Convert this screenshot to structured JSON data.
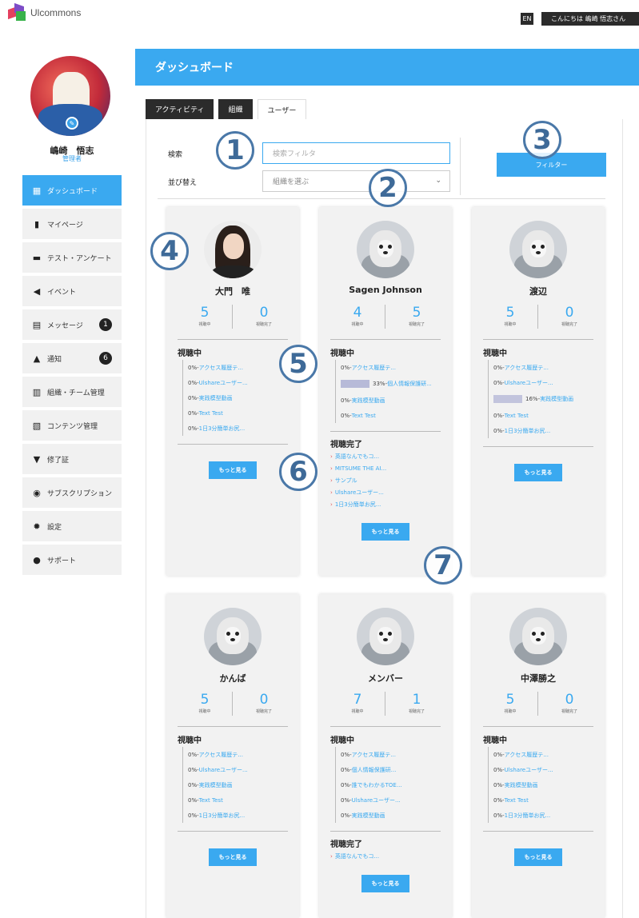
{
  "app": {
    "logo_text": "Ulcommons"
  },
  "topbar": {
    "lang": "EN",
    "greeting": "こんにちは 嶋崎 悟志さん"
  },
  "profile": {
    "name": "嶋崎　悟志",
    "role": "管理者"
  },
  "sidebar": {
    "items": [
      {
        "label": "ダッシュボード",
        "icon": "dashboard-icon",
        "active": true
      },
      {
        "label": "マイページ",
        "icon": "book-icon"
      },
      {
        "label": "テスト・アンケート",
        "icon": "test-icon"
      },
      {
        "label": "イベント",
        "icon": "megaphone-icon"
      },
      {
        "label": "メッセージ",
        "icon": "message-icon",
        "badge": "1"
      },
      {
        "label": "通知",
        "icon": "bell-icon",
        "badge": "6"
      },
      {
        "label": "組織・チーム管理",
        "icon": "team-icon"
      },
      {
        "label": "コンテンツ管理",
        "icon": "content-icon"
      },
      {
        "label": "修了証",
        "icon": "medal-icon"
      },
      {
        "label": "サブスクリプション",
        "icon": "subscription-icon"
      },
      {
        "label": "設定",
        "icon": "gear-icon"
      },
      {
        "label": "サポート",
        "icon": "info-icon"
      }
    ]
  },
  "header": {
    "title": "ダッシュボード"
  },
  "tabs": [
    {
      "label": "アクティビティ"
    },
    {
      "label": "組織"
    },
    {
      "label": "ユーザー",
      "active": true
    }
  ],
  "filters": {
    "search_label": "検索",
    "search_placeholder": "検索フィルタ",
    "sort_label": "並び替え",
    "sort_value": "組織を選ぶ",
    "filter_button": "フィルター"
  },
  "labels": {
    "watching": "視聴中",
    "completed": "視聴完了",
    "stat_watching": "視聴中",
    "stat_completed": "視聴完了",
    "more": "もっと見る"
  },
  "annotations": [
    "1",
    "2",
    "3",
    "4",
    "5",
    "6",
    "7"
  ],
  "cards": [
    {
      "name": "大門　唯",
      "watching_count": "5",
      "completed_count": "0",
      "watching": [
        {
          "pct": "0%",
          "title": "アクセス履歴テ..."
        },
        {
          "pct": "0%",
          "title": "Ulshareユーザー..."
        },
        {
          "pct": "0%",
          "title": "実践模型動画"
        },
        {
          "pct": "0%",
          "title": "Text Test"
        },
        {
          "pct": "0%",
          "title": "1日3分簡単お尻..."
        }
      ],
      "completed": []
    },
    {
      "name": "Sagen Johnson",
      "watching_count": "4",
      "completed_count": "5",
      "watching": [
        {
          "pct": "0%",
          "title": "アクセス履歴テ..."
        },
        {
          "pct": "33%",
          "title": "個人情報保護研...",
          "progress": 0.33
        },
        {
          "pct": "0%",
          "title": "実践模型動画"
        },
        {
          "pct": "0%",
          "title": "Text Test"
        }
      ],
      "completed": [
        {
          "title": "英語なんでもコ..."
        },
        {
          "title": "MITSUME THE AI..."
        },
        {
          "title": "サンプル"
        },
        {
          "title": "Ulshareユーザー..."
        },
        {
          "title": "1日3分簡単お尻..."
        }
      ]
    },
    {
      "name": "渡辺",
      "watching_count": "5",
      "completed_count": "0",
      "watching": [
        {
          "pct": "0%",
          "title": "アクセス履歴テ..."
        },
        {
          "pct": "0%",
          "title": "Ulshareユーザー..."
        },
        {
          "pct": "16%",
          "title": "実践模型動画",
          "progress": 0.16
        },
        {
          "pct": "0%",
          "title": "Text Test"
        },
        {
          "pct": "0%",
          "title": "1日3分簡単お尻..."
        }
      ],
      "completed": []
    },
    {
      "name": "かんば",
      "watching_count": "5",
      "completed_count": "0",
      "watching": [
        {
          "pct": "0%",
          "title": "アクセス履歴テ..."
        },
        {
          "pct": "0%",
          "title": "Ulshareユーザー..."
        },
        {
          "pct": "0%",
          "title": "実践模型動画"
        },
        {
          "pct": "0%",
          "title": "Text Test"
        },
        {
          "pct": "0%",
          "title": "1日3分簡単お尻..."
        }
      ],
      "completed": []
    },
    {
      "name": "メンバー",
      "watching_count": "7",
      "completed_count": "1",
      "watching": [
        {
          "pct": "0%",
          "title": "アクセス履歴テ..."
        },
        {
          "pct": "0%",
          "title": "個人情報保護研..."
        },
        {
          "pct": "0%",
          "title": "誰でもわかるTOE..."
        },
        {
          "pct": "0%",
          "title": "Ulshareユーザー..."
        },
        {
          "pct": "0%",
          "title": "実践模型動画"
        }
      ],
      "completed": [
        {
          "title": "英語なんでもコ..."
        }
      ]
    },
    {
      "name": "中澤勝之",
      "watching_count": "5",
      "completed_count": "0",
      "watching": [
        {
          "pct": "0%",
          "title": "アクセス履歴テ..."
        },
        {
          "pct": "0%",
          "title": "Ulshareユーザー..."
        },
        {
          "pct": "0%",
          "title": "実践模型動画"
        },
        {
          "pct": "0%",
          "title": "Text Test"
        },
        {
          "pct": "0%",
          "title": "1日3分簡単お尻..."
        }
      ],
      "completed": []
    }
  ]
}
